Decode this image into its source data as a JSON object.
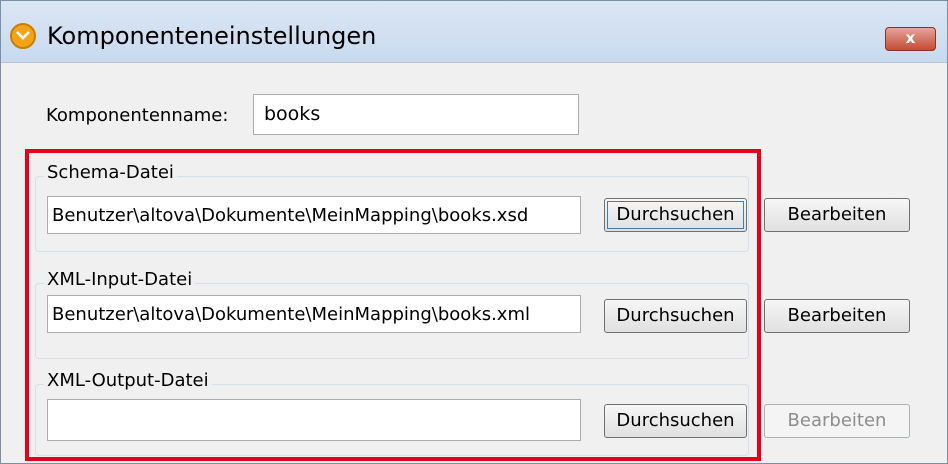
{
  "window": {
    "title": "Komponenteneinstellungen",
    "close_label": "x"
  },
  "component": {
    "name_label": "Komponentenname:",
    "name_value": "books"
  },
  "schema": {
    "group_label": "Schema-Datei",
    "path": "Benutzer\\altova\\Dokumente\\MeinMapping\\books.xsd",
    "browse_label": "Durchsuchen",
    "edit_label": "Bearbeiten"
  },
  "xml_input": {
    "group_label": "XML-Input-Datei",
    "path": "Benutzer\\altova\\Dokumente\\MeinMapping\\books.xml",
    "browse_label": "Durchsuchen",
    "edit_label": "Bearbeiten"
  },
  "xml_output": {
    "group_label": "XML-Output-Datei",
    "path": "",
    "browse_label": "Durchsuchen",
    "edit_label": "Bearbeiten",
    "edit_enabled": false
  },
  "colors": {
    "highlight": "#e3001b",
    "app_icon": "#f2a318",
    "close_button": "#c54b34"
  }
}
